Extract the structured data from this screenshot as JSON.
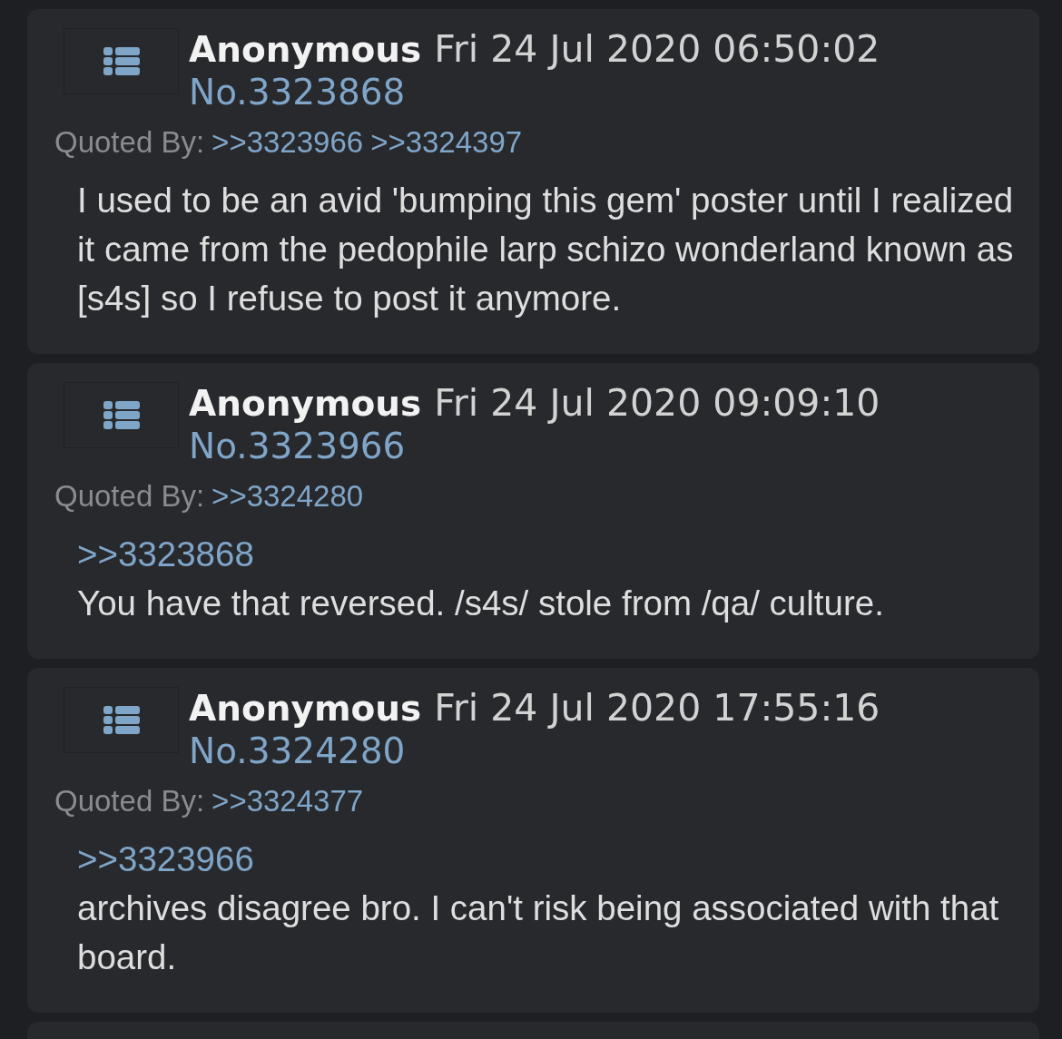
{
  "posts": [
    {
      "name": "Anonymous",
      "date": "Fri 24 Jul 2020 06:50:02",
      "number": "No.3323868",
      "quoted_by_label": "Quoted By:",
      "quoted_by": [
        ">>3323966",
        ">>3324397"
      ],
      "body": "I used to be an avid 'bumping this gem' poster until I realized it came from the pedophile larp schizo wonderland known as [s4s] so I refuse to post it anymore."
    },
    {
      "name": "Anonymous",
      "date": "Fri 24 Jul 2020 09:09:10",
      "number": "No.3323966",
      "quoted_by_label": "Quoted By:",
      "quoted_by": [
        ">>3324280"
      ],
      "quotes": [
        ">>3323868"
      ],
      "body": "You have that reversed. /s4s/ stole from /qa/ culture."
    },
    {
      "name": "Anonymous",
      "date": "Fri 24 Jul 2020 17:55:16",
      "number": "No.3324280",
      "quoted_by_label": "Quoted By:",
      "quoted_by": [
        ">>3324377"
      ],
      "quotes": [
        ">>3323966"
      ],
      "body": "archives disagree bro. I can't risk being associated with that board."
    }
  ]
}
